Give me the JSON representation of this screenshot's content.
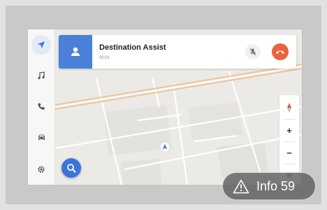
{
  "call": {
    "name": "Destination Assist",
    "timer": "00:01"
  },
  "map_controls": {
    "zoom_in": "+",
    "zoom_out": "−",
    "menu": "≡"
  },
  "road_labels": [
    "",
    "",
    ""
  ],
  "info_badge": {
    "text": "Info 59"
  },
  "colors": {
    "accent_blue": "#3d74d9",
    "avatar_blue": "#4a80d8",
    "end_call": "#e8643c",
    "road_orange": "#f0c49c",
    "compass_red": "#e0553a"
  },
  "icons": {
    "sidebar": [
      "navigation-arrow-icon",
      "music-note-icon",
      "phone-icon",
      "car-icon",
      "gear-icon"
    ],
    "call": [
      "person-icon",
      "mute-mic-icon",
      "end-call-icon"
    ],
    "map": [
      "compass-icon",
      "search-icon",
      "position-arrow-icon"
    ],
    "badge": "warning-triangle-icon"
  }
}
